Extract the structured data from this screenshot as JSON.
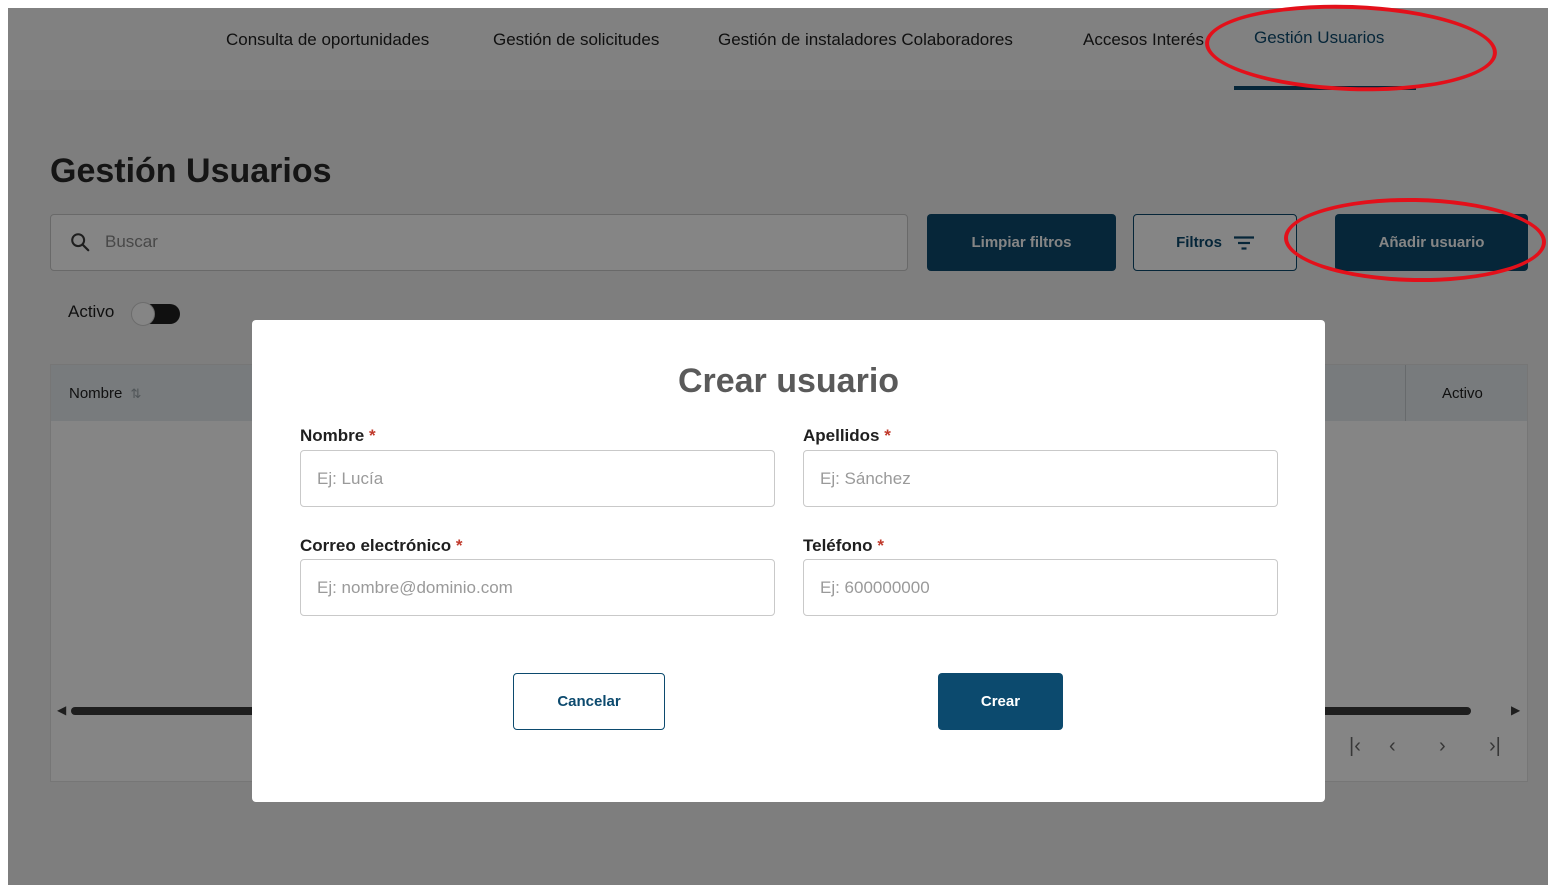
{
  "nav": {
    "items": [
      {
        "label": "Consulta de oportunidades"
      },
      {
        "label": "Gestión de solicitudes"
      },
      {
        "label": "Gestión de instaladores Colaboradores"
      },
      {
        "label": "Accesos Interés"
      },
      {
        "label": "Gestión Usuarios",
        "active": true
      }
    ]
  },
  "page": {
    "title": "Gestión Usuarios",
    "search_placeholder": "Buscar",
    "clear_filters_label": "Limpiar filtros",
    "filters_label": "Filtros",
    "add_user_label": "Añadir usuario",
    "activo_label": "Activo",
    "activo_toggle_on": false,
    "table": {
      "columns": [
        "Nombre",
        "Activo"
      ]
    }
  },
  "modal": {
    "title": "Crear usuario",
    "fields": {
      "nombre": {
        "label": "Nombre",
        "required_mark": "*",
        "placeholder": "Ej: Lucía",
        "value": ""
      },
      "apellidos": {
        "label": "Apellidos",
        "required_mark": "*",
        "placeholder": "Ej: Sánchez",
        "value": ""
      },
      "correo": {
        "label": "Correo electrónico",
        "required_mark": "*",
        "placeholder": "Ej: nombre@dominio.com",
        "value": ""
      },
      "telefono": {
        "label": "Teléfono",
        "required_mark": "*",
        "placeholder": "Ej: 600000000",
        "value": ""
      }
    },
    "cancel_label": "Cancelar",
    "create_label": "Crear"
  },
  "colors": {
    "primary": "#0c4a6e",
    "annotation": "#e3101a",
    "required": "#c0392b"
  },
  "icons": [
    "search-icon",
    "filter-icon",
    "sort-icon",
    "first-page-icon",
    "prev-page-icon",
    "next-page-icon",
    "last-page-icon"
  ]
}
